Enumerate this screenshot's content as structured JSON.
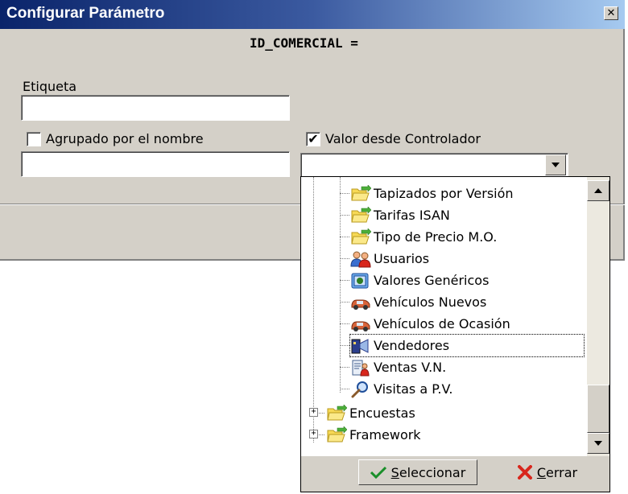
{
  "dialog": {
    "title": "Configurar Parámetro",
    "close_glyph": "✕",
    "param_name": "ID_COMERCIAL =",
    "etiqueta_label": "Etiqueta",
    "etiqueta_value": "",
    "agrupado_label": "Agrupado por el nombre",
    "agrupado_checked": false,
    "agrupado_value": "",
    "valor_label": "Valor desde Controlador",
    "valor_checked": true,
    "valor_value": ""
  },
  "dropdown": {
    "items": [
      {
        "label": "Tapizados por Versión",
        "icon": "folder-arrow-icon"
      },
      {
        "label": "Tarifas ISAN",
        "icon": "folder-arrow-icon"
      },
      {
        "label": "Tipo de Precio M.O.",
        "icon": "folder-arrow-icon"
      },
      {
        "label": "Usuarios",
        "icon": "users-icon"
      },
      {
        "label": "Valores Genéricos",
        "icon": "generic-values-icon"
      },
      {
        "label": "Vehículos Nuevos",
        "icon": "car-icon"
      },
      {
        "label": "Vehículos de Ocasión",
        "icon": "car-icon"
      },
      {
        "label": "Vendedores",
        "icon": "salesperson-icon"
      },
      {
        "label": "Ventas V.N.",
        "icon": "sales-icon"
      },
      {
        "label": "Visitas a P.V.",
        "icon": "magnifier-icon"
      }
    ],
    "root_items": [
      {
        "label": "Encuestas",
        "icon": "folder-arrow-icon",
        "expander": "+"
      },
      {
        "label": "Framework",
        "icon": "folder-arrow-icon",
        "expander": "+"
      }
    ],
    "selected_label": "Vendedores",
    "select_button": "Seleccionar",
    "close_button": "Cerrar"
  },
  "colors": {
    "face": "#d4d0c8",
    "title_start": "#0a246a",
    "title_end": "#a6caf0",
    "check_green": "#1a8f2a",
    "close_red": "#d8261c"
  }
}
